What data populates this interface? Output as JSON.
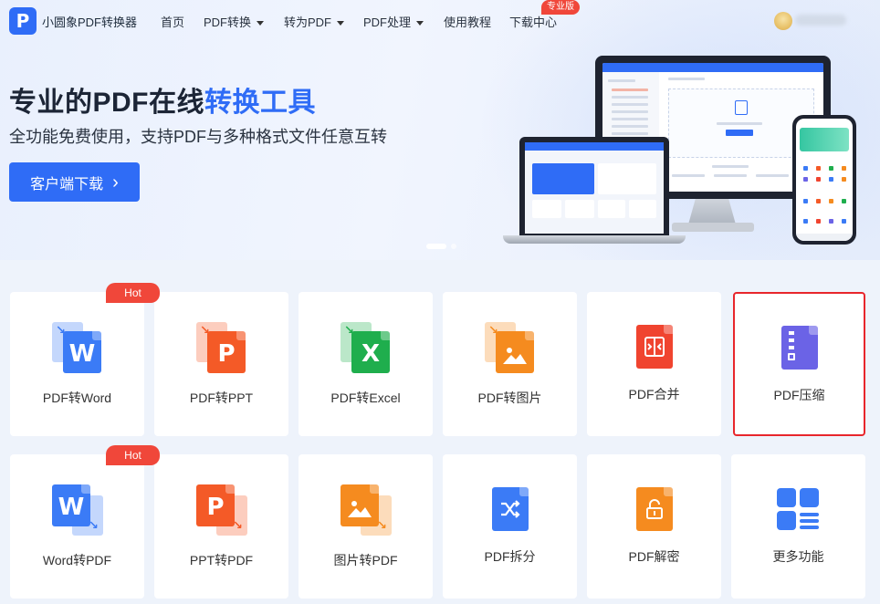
{
  "nav": {
    "logo_letter": "P",
    "brand": "小圆象PDF转换器",
    "items": [
      "首页",
      "PDF转换",
      "转为PDF",
      "PDF处理",
      "使用教程",
      "下载中心"
    ],
    "pro_badge": "专业版"
  },
  "hero": {
    "title_part1": "专业的PDF在线",
    "title_part2": "转换工具",
    "subtitle": "全功能免费使用，支持PDF与多种格式文件任意互转",
    "download_button": "客户端下载",
    "download_arrow": "›"
  },
  "tools": [
    {
      "label": "PDF转Word",
      "hot": "Hot",
      "icon": "pdf-to-word-icon",
      "color": "#3b7bf6",
      "letter": "W"
    },
    {
      "label": "PDF转PPT",
      "icon": "pdf-to-ppt-icon",
      "color": "#f45a27",
      "letter": "P"
    },
    {
      "label": "PDF转Excel",
      "icon": "pdf-to-excel-icon",
      "color": "#1fae4d",
      "letter": "X"
    },
    {
      "label": "PDF转图片",
      "icon": "pdf-to-image-icon",
      "color": "#f58b1f"
    },
    {
      "label": "PDF合并",
      "icon": "pdf-merge-icon",
      "color": "#f0442f"
    },
    {
      "label": "PDF压缩",
      "icon": "pdf-compress-icon",
      "color": "#6b63e6",
      "selected": true
    },
    {
      "label": "Word转PDF",
      "hot": "Hot",
      "icon": "word-to-pdf-icon",
      "color": "#3b7bf6",
      "letter": "W"
    },
    {
      "label": "PPT转PDF",
      "icon": "ppt-to-pdf-icon",
      "color": "#f45a27",
      "letter": "P"
    },
    {
      "label": "图片转PDF",
      "icon": "image-to-pdf-icon",
      "color": "#f58b1f"
    },
    {
      "label": "PDF拆分",
      "icon": "pdf-split-icon",
      "color": "#3b7bf6"
    },
    {
      "label": "PDF解密",
      "icon": "pdf-decrypt-icon",
      "color": "#f58b1f"
    },
    {
      "label": "更多功能",
      "icon": "more-functions-icon",
      "color": "#3b7bf6"
    }
  ]
}
